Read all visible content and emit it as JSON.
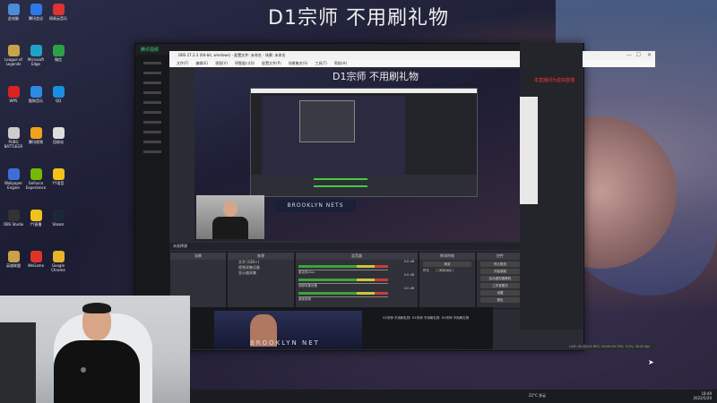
{
  "stream": {
    "title": "D1宗师 不用刷礼物",
    "inner_title": "D1宗师 不用刷礼物"
  },
  "desktop_icons": [
    {
      "label": "此电脑",
      "icon": "computer-icon",
      "color": "#4a8cd8"
    },
    {
      "label": "腾讯会议",
      "icon": "meeting-icon",
      "color": "#2c7be5"
    },
    {
      "label": "网易云音乐",
      "icon": "music-icon",
      "color": "#d33"
    },
    {
      "label": "League of Legends",
      "icon": "lol-icon",
      "color": "#c9a24a"
    },
    {
      "label": "Microsoft Edge",
      "icon": "edge-icon",
      "color": "#1fa3c9"
    },
    {
      "label": "微信",
      "icon": "wechat-icon",
      "color": "#2ba245"
    },
    {
      "label": "WPS",
      "icon": "wps-icon",
      "color": "#d22"
    },
    {
      "label": "酷狗音乐",
      "icon": "kugou-icon",
      "color": "#2b8be5"
    },
    {
      "label": "QQ",
      "icon": "qq-icon",
      "color": "#1a8fe0"
    },
    {
      "label": "PUBG BATTLEGR",
      "icon": "pubg-icon",
      "color": "#ccc"
    },
    {
      "label": "腾讯视频",
      "icon": "video-icon",
      "color": "#f2a21a"
    },
    {
      "label": "回收站",
      "icon": "recycle-icon",
      "color": "#ddd"
    },
    {
      "label": "Wallpaper Engine",
      "icon": "wallpaper-icon",
      "color": "#3c6ed8"
    },
    {
      "label": "GeForce Experience",
      "icon": "geforce-icon",
      "color": "#76b900"
    },
    {
      "label": "YY语音",
      "icon": "yy-icon",
      "color": "#f2c21a"
    },
    {
      "label": "OBS Studio",
      "icon": "obs-icon",
      "color": "#333"
    },
    {
      "label": "YY直播",
      "icon": "yy-live-icon",
      "color": "#f2c21a"
    },
    {
      "label": "Steam",
      "icon": "steam-icon",
      "color": "#1b2838"
    },
    {
      "label": "英雄联盟",
      "icon": "hero-icon",
      "color": "#c9a24a"
    },
    {
      "label": "WeGame",
      "icon": "wegame-icon",
      "color": "#e0342b"
    },
    {
      "label": "Google Chrome",
      "icon": "chrome-icon",
      "color": "#e8b42a"
    }
  ],
  "tencent": {
    "logo": "腾讯视频"
  },
  "obs": {
    "titlebar": "OBS 27.2.3 (64-bit, windows) - 配置文件: 未命名 - 场景: 未命名",
    "menu": [
      "文件(F)",
      "编辑(E)",
      "视图(V)",
      "停靠窗口(D)",
      "配置文件(P)",
      "场景集合(S)",
      "工具(T)",
      "帮助(H)"
    ],
    "preview_banner": "BROOKLYN NETS",
    "scenes_header": "未选择源",
    "docks": {
      "scenes": {
        "title": "场景"
      },
      "sources": {
        "title": "来源",
        "items": [
          "文字 (GDI+)",
          "视频采集设备",
          "显示器采集"
        ]
      },
      "mixer": {
        "title": "混音器",
        "channels": [
          {
            "name": "麦克风/Aux",
            "db": "0.0 dB"
          },
          {
            "name": "视频采集设备",
            "db": "0.0 dB"
          },
          {
            "name": "桌面音频",
            "db": "0.0 dB"
          }
        ]
      },
      "transitions": {
        "title": "转场特效",
        "type": "渐变",
        "duration_label": "时长",
        "duration": "300 ms"
      },
      "controls": {
        "title": "控件",
        "buttons": [
          "停止推流",
          "开始录制",
          "启动虚拟摄像机",
          "工作室模式",
          "设置",
          "退出"
        ]
      }
    },
    "status": "LIVE: 00:00:00   REC: 00:00:00   CPU: 3.2%, 30.00 fps"
  },
  "right_panel": {
    "red_note": "本直播间为虚拟直播"
  },
  "bottom_strip": {
    "banner": "BROOKLYN NET",
    "thumbs": [
      "D1宗师 不用刷礼物",
      "D1宗师 不用刷礼物",
      "D1宗师 不用刷礼物"
    ]
  },
  "taskbar": {
    "weather": "22°C 多云",
    "time": "18:49",
    "date": "2022/5/20"
  },
  "colors": {
    "obs_bg": "#2b2c33",
    "meter_green": "#3ca33c",
    "meter_yellow": "#c8c83c",
    "meter_red": "#c83c3c",
    "tencent_green": "#3fd27b"
  }
}
